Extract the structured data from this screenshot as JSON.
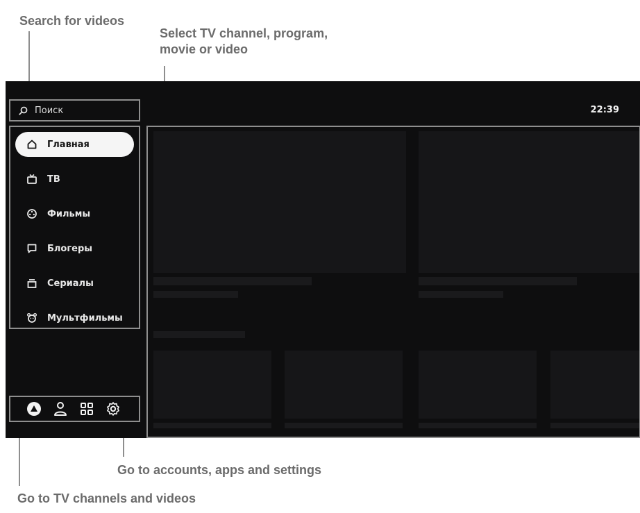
{
  "callouts": {
    "search": "Search for videos",
    "select_line1": "Select TV channel, program,",
    "select_line2": "movie or video",
    "accounts": "Go to accounts, apps and settings",
    "channels": "Go to TV channels and videos"
  },
  "status": {
    "clock": "22:39"
  },
  "search": {
    "label": "Поиск",
    "icon": "search-icon"
  },
  "sidebar": {
    "items": [
      {
        "label": "Главная",
        "icon": "home-icon",
        "active": true
      },
      {
        "label": "ТВ",
        "icon": "tv-icon",
        "active": false
      },
      {
        "label": "Фильмы",
        "icon": "film-reel-icon",
        "active": false
      },
      {
        "label": "Блогеры",
        "icon": "bloggers-icon",
        "active": false
      },
      {
        "label": "Сериалы",
        "icon": "series-icon",
        "active": false
      },
      {
        "label": "Мультфильмы",
        "icon": "cartoon-icon",
        "active": false
      }
    ]
  },
  "bottom_bar": {
    "icons": [
      "assistant-icon",
      "profile-icon",
      "apps-grid-icon",
      "settings-gear-icon"
    ]
  },
  "colors": {
    "screen_bg": "#0e0e0f",
    "tile_bg": "#161618",
    "callout_text": "#6b6b6b",
    "outline": "#8e8e8e",
    "active_item_bg": "#f5f5f5"
  }
}
